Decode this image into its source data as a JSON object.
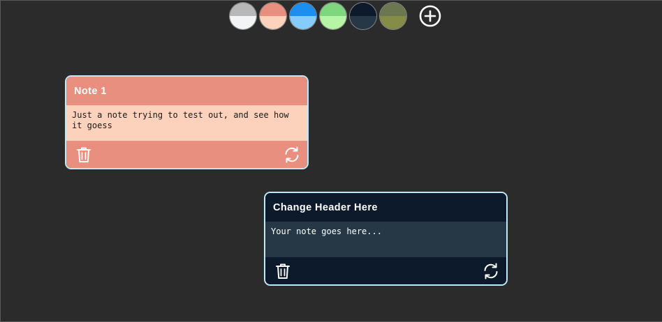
{
  "palette": [
    {
      "name": "gray",
      "header": "#b8b8b8",
      "body": "#f2f4f5"
    },
    {
      "name": "salmon",
      "header": "#e88f80",
      "body": "#fcd2bd"
    },
    {
      "name": "blue",
      "header": "#1a8fef",
      "body": "#86ccfa"
    },
    {
      "name": "green",
      "header": "#7fd67f",
      "body": "#b5f5a5"
    },
    {
      "name": "navy",
      "header": "#0c1a2c",
      "body": "#263845"
    },
    {
      "name": "olive",
      "header": "#6a7750",
      "body": "#848c48"
    }
  ],
  "add_icon": "plus-circle-icon",
  "notes": [
    {
      "title": "Note 1",
      "body": "Just a note trying to test out, and see how it goess",
      "header_color": "#e88f80",
      "body_color": "#fcd2bd",
      "body_text_color": "#1a1a1a",
      "delete_icon": "trash-icon",
      "color_cycle_icon": "refresh-icon"
    },
    {
      "title": "Change Header Here",
      "body": "Your note goes here...",
      "header_color": "#0c1a2c",
      "body_color": "#263845",
      "body_text_color": "#ffffff",
      "delete_icon": "trash-icon",
      "color_cycle_icon": "refresh-icon"
    }
  ]
}
